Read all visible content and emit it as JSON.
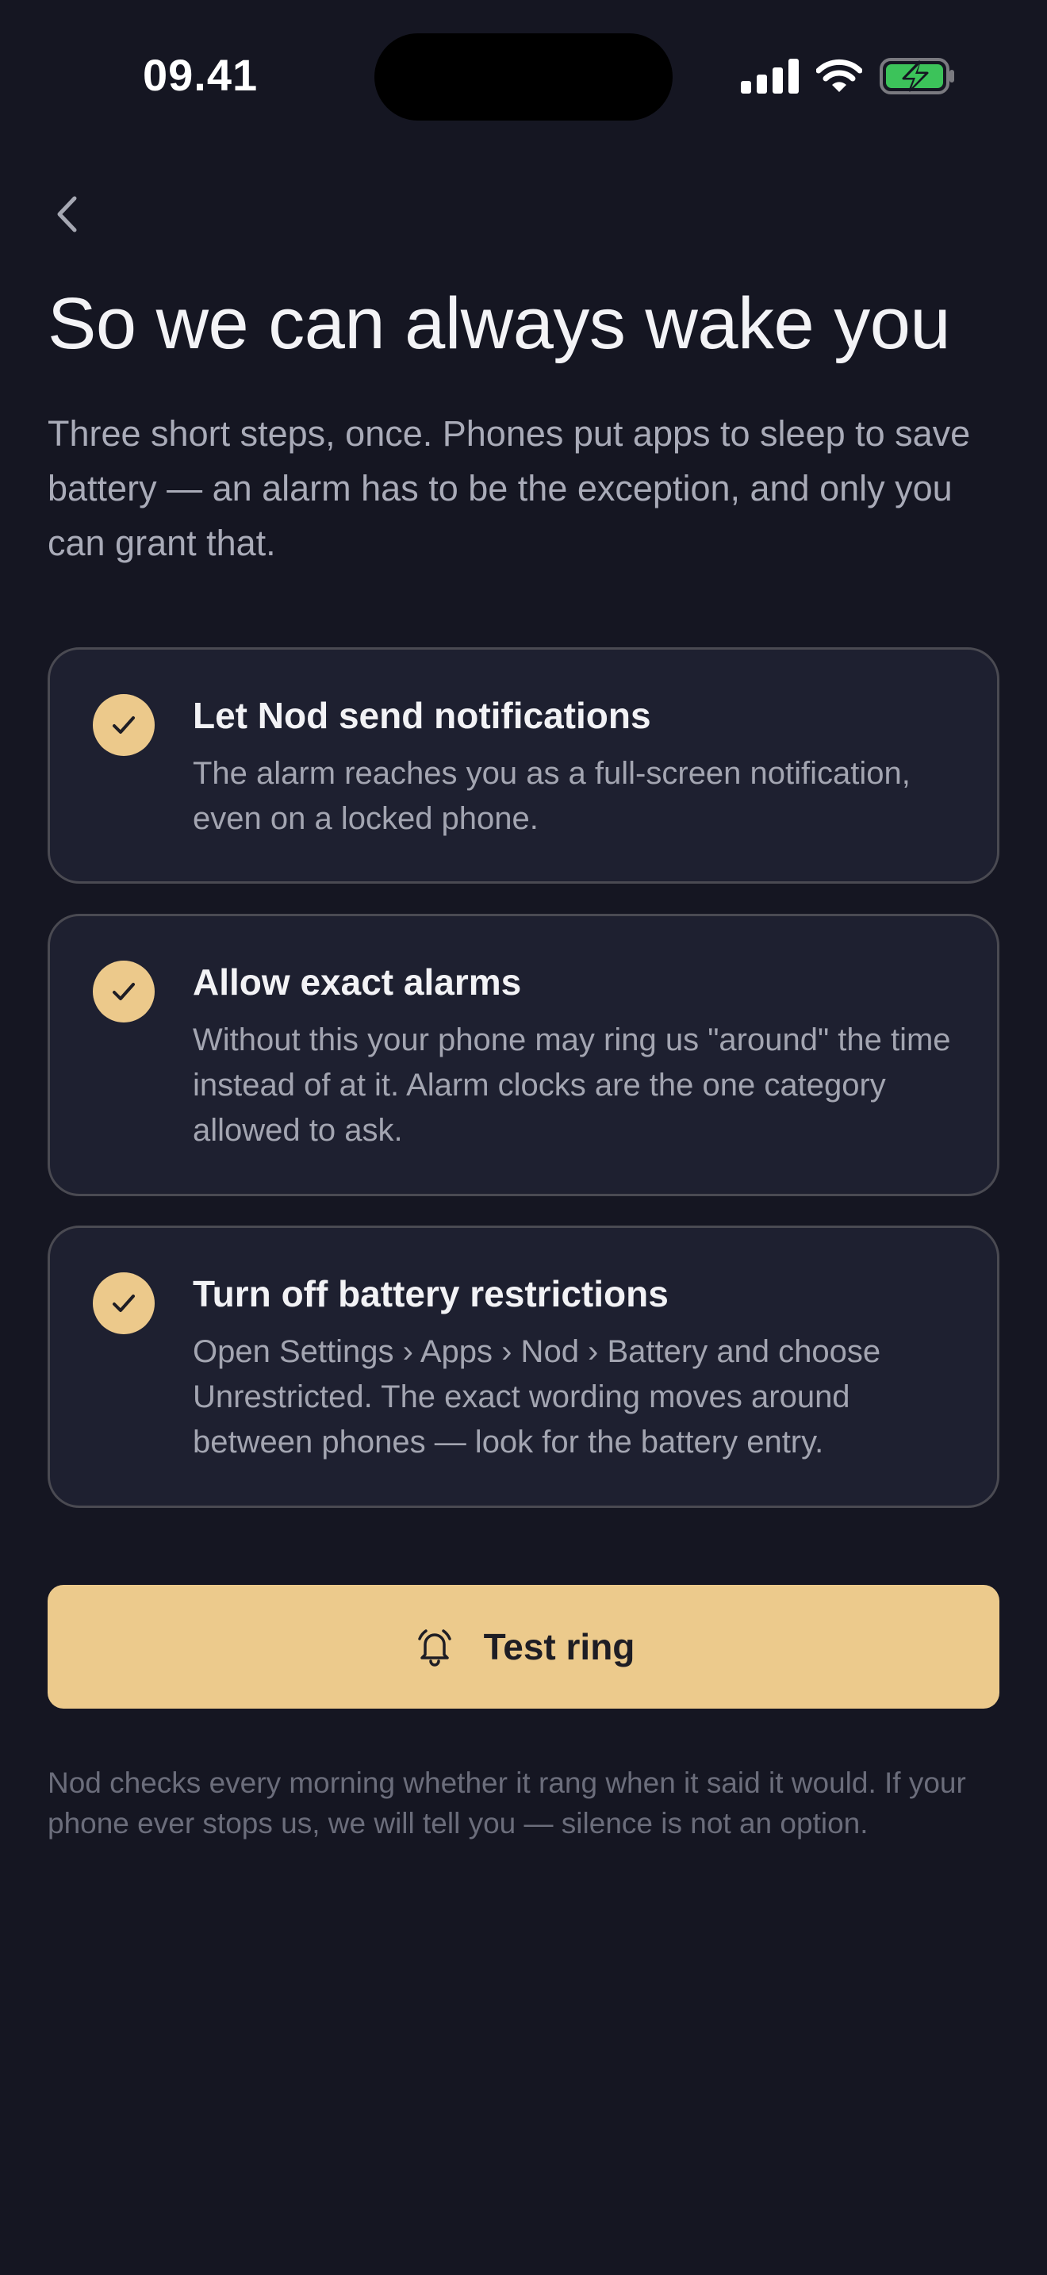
{
  "status_bar": {
    "time": "09.41"
  },
  "header": {
    "back_icon": "chevron-left-icon",
    "title": "So we can always wake you",
    "intro": "Three short steps, once. Phones put apps to sleep to save battery — an alarm has to be the exception, and only you can grant that."
  },
  "steps": [
    {
      "title": "Let Nod send notifications",
      "description": "The alarm reaches you as a full-screen notification, even on a locked phone.",
      "checked": true
    },
    {
      "title": "Allow exact alarms",
      "description": "Without this your phone may ring us \"around\" the time instead of at it. Alarm clocks are the one category allowed to ask.",
      "checked": true
    },
    {
      "title": "Turn off battery restrictions",
      "description": "Open Settings › Apps › Nod › Battery and choose Unrestricted. The exact wording moves around between phones — look for the battery entry.",
      "checked": true
    }
  ],
  "test_button": {
    "label": "Test ring",
    "icon": "bell-ringing-icon"
  },
  "footnote": "Nod checks every morning whether it rang when it said it would. If your phone ever stops us, we will tell you — silence is not an option.",
  "colors": {
    "background": "#151622",
    "card": "#1e2030",
    "card_border": "#4a4a52",
    "accent": "#ecca8c",
    "battery_green": "#3cc35a"
  }
}
